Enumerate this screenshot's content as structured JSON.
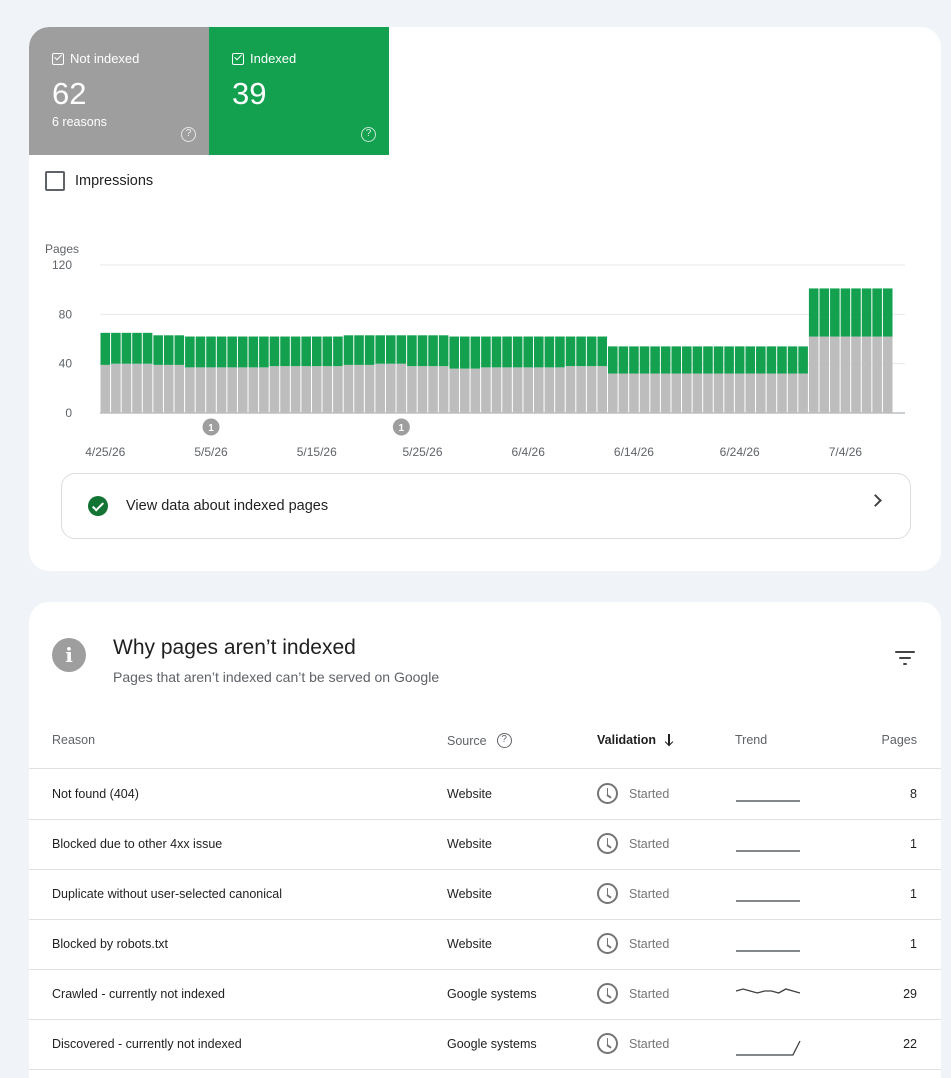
{
  "tiles": {
    "not_indexed": {
      "label": "Not indexed",
      "count": "62",
      "sub": "6 reasons",
      "color": "#9e9e9e"
    },
    "indexed": {
      "label": "Indexed",
      "count": "39",
      "color": "#13a14f"
    }
  },
  "impressions_label": "Impressions",
  "chart_data": {
    "type": "bar",
    "stacked": true,
    "ylabel": "Pages",
    "yticks": [
      0,
      40,
      80,
      120
    ],
    "ylim": [
      0,
      120
    ],
    "x_tick_labels": [
      "4/25/26",
      "5/5/26",
      "5/15/26",
      "5/25/26",
      "6/4/26",
      "6/14/26",
      "6/24/26",
      "7/4/26"
    ],
    "annotations": [
      {
        "date": "5/5/26",
        "label": "1"
      },
      {
        "date": "5/23/26",
        "label": "1"
      }
    ],
    "dates": [
      "4/25/26",
      "4/26/26",
      "4/27/26",
      "4/28/26",
      "4/29/26",
      "4/30/26",
      "5/1/26",
      "5/2/26",
      "5/3/26",
      "5/4/26",
      "5/5/26",
      "5/6/26",
      "5/7/26",
      "5/8/26",
      "5/9/26",
      "5/10/26",
      "5/11/26",
      "5/12/26",
      "5/13/26",
      "5/14/26",
      "5/15/26",
      "5/16/26",
      "5/17/26",
      "5/18/26",
      "5/19/26",
      "5/20/26",
      "5/21/26",
      "5/22/26",
      "5/23/26",
      "5/24/26",
      "5/25/26",
      "5/26/26",
      "5/27/26",
      "5/28/26",
      "5/29/26",
      "5/30/26",
      "5/31/26",
      "6/1/26",
      "6/2/26",
      "6/3/26",
      "6/4/26",
      "6/5/26",
      "6/6/26",
      "6/7/26",
      "6/8/26",
      "6/9/26",
      "6/10/26",
      "6/11/26",
      "6/12/26",
      "6/13/26",
      "6/14/26",
      "6/15/26",
      "6/16/26",
      "6/17/26",
      "6/18/26",
      "6/19/26",
      "6/20/26",
      "6/21/26",
      "6/22/26",
      "6/23/26",
      "6/24/26",
      "6/25/26",
      "6/26/26",
      "6/27/26",
      "6/28/26",
      "6/29/26",
      "6/30/26",
      "7/1/26",
      "7/2/26",
      "7/3/26",
      "7/4/26",
      "7/5/26",
      "7/6/26",
      "7/7/26",
      "7/8/26"
    ],
    "series": [
      {
        "name": "Not indexed",
        "color": "#bdbdbd",
        "values": [
          39,
          40,
          40,
          40,
          40,
          39,
          39,
          39,
          37,
          37,
          37,
          37,
          37,
          37,
          37,
          37,
          38,
          38,
          38,
          38,
          38,
          38,
          38,
          39,
          39,
          39,
          40,
          40,
          40,
          38,
          38,
          38,
          38,
          36,
          36,
          36,
          37,
          37,
          37,
          37,
          37,
          37,
          37,
          37,
          38,
          38,
          38,
          38,
          32,
          32,
          32,
          32,
          32,
          32,
          32,
          32,
          32,
          32,
          32,
          32,
          32,
          32,
          32,
          32,
          32,
          32,
          32,
          62,
          62,
          62,
          62,
          62,
          62,
          62,
          62
        ]
      },
      {
        "name": "Indexed",
        "color": "#13a14f",
        "values": [
          26,
          25,
          25,
          25,
          25,
          24,
          24,
          24,
          25,
          25,
          25,
          25,
          25,
          25,
          25,
          25,
          24,
          24,
          24,
          24,
          24,
          24,
          24,
          24,
          24,
          24,
          23,
          23,
          23,
          25,
          25,
          25,
          25,
          26,
          26,
          26,
          25,
          25,
          25,
          25,
          25,
          25,
          25,
          25,
          24,
          24,
          24,
          24,
          22,
          22,
          22,
          22,
          22,
          22,
          22,
          22,
          22,
          22,
          22,
          22,
          22,
          22,
          22,
          22,
          22,
          22,
          22,
          39,
          39,
          39,
          39,
          39,
          39,
          39,
          39
        ]
      }
    ]
  },
  "view_data_label": "View data about indexed pages",
  "section": {
    "title": "Why pages aren’t indexed",
    "subtitle": "Pages that aren’t indexed can’t be served on Google"
  },
  "table": {
    "headers": {
      "reason": "Reason",
      "source": "Source",
      "validation": "Validation",
      "trend": "Trend",
      "pages": "Pages"
    },
    "rows": [
      {
        "reason": "Not found (404)",
        "source": "Website",
        "validation": "Started",
        "pages": "8",
        "trend": [
          1,
          1,
          1,
          1,
          1,
          1,
          1,
          1,
          1,
          1
        ]
      },
      {
        "reason": "Blocked due to other 4xx issue",
        "source": "Website",
        "validation": "Started",
        "pages": "1",
        "trend": [
          1,
          1,
          1,
          1,
          1,
          1,
          1,
          1,
          1,
          1
        ]
      },
      {
        "reason": "Duplicate without user-selected canonical",
        "source": "Website",
        "validation": "Started",
        "pages": "1",
        "trend": [
          1,
          1,
          1,
          1,
          1,
          1,
          1,
          1,
          1,
          1
        ]
      },
      {
        "reason": "Blocked by robots.txt",
        "source": "Website",
        "validation": "Started",
        "pages": "1",
        "trend": [
          1,
          1,
          1,
          1,
          1,
          1,
          1,
          1,
          1,
          1
        ]
      },
      {
        "reason": "Crawled - currently not indexed",
        "source": "Google systems",
        "validation": "Started",
        "pages": "29",
        "trend": [
          30,
          31,
          30,
          29,
          30,
          30,
          29,
          31,
          30,
          29
        ]
      },
      {
        "reason": "Discovered - currently not indexed",
        "source": "Google systems",
        "validation": "Started",
        "pages": "22",
        "trend": [
          1,
          1,
          1,
          1,
          1,
          1,
          1,
          1,
          1,
          22
        ]
      }
    ]
  },
  "colors": {
    "accent_green": "#13a14f",
    "check_green": "#137333",
    "grey_bar": "#bdbdbd"
  }
}
